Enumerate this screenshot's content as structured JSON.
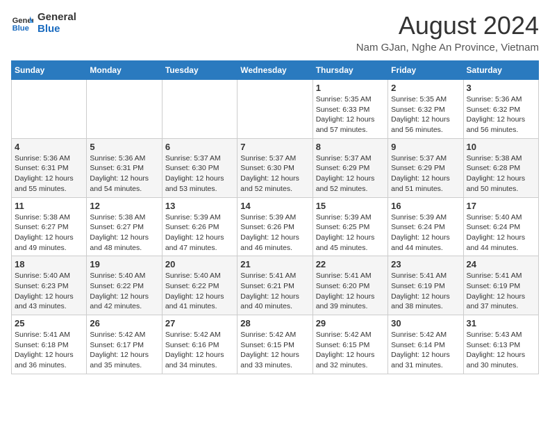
{
  "header": {
    "logo_line1": "General",
    "logo_line2": "Blue",
    "title": "August 2024",
    "subtitle": "Nam GJan, Nghe An Province, Vietnam"
  },
  "days_of_week": [
    "Sunday",
    "Monday",
    "Tuesday",
    "Wednesday",
    "Thursday",
    "Friday",
    "Saturday"
  ],
  "weeks": [
    [
      {
        "day": "",
        "detail": ""
      },
      {
        "day": "",
        "detail": ""
      },
      {
        "day": "",
        "detail": ""
      },
      {
        "day": "",
        "detail": ""
      },
      {
        "day": "1",
        "detail": "Sunrise: 5:35 AM\nSunset: 6:33 PM\nDaylight: 12 hours\nand 57 minutes."
      },
      {
        "day": "2",
        "detail": "Sunrise: 5:35 AM\nSunset: 6:32 PM\nDaylight: 12 hours\nand 56 minutes."
      },
      {
        "day": "3",
        "detail": "Sunrise: 5:36 AM\nSunset: 6:32 PM\nDaylight: 12 hours\nand 56 minutes."
      }
    ],
    [
      {
        "day": "4",
        "detail": "Sunrise: 5:36 AM\nSunset: 6:31 PM\nDaylight: 12 hours\nand 55 minutes."
      },
      {
        "day": "5",
        "detail": "Sunrise: 5:36 AM\nSunset: 6:31 PM\nDaylight: 12 hours\nand 54 minutes."
      },
      {
        "day": "6",
        "detail": "Sunrise: 5:37 AM\nSunset: 6:30 PM\nDaylight: 12 hours\nand 53 minutes."
      },
      {
        "day": "7",
        "detail": "Sunrise: 5:37 AM\nSunset: 6:30 PM\nDaylight: 12 hours\nand 52 minutes."
      },
      {
        "day": "8",
        "detail": "Sunrise: 5:37 AM\nSunset: 6:29 PM\nDaylight: 12 hours\nand 52 minutes."
      },
      {
        "day": "9",
        "detail": "Sunrise: 5:37 AM\nSunset: 6:29 PM\nDaylight: 12 hours\nand 51 minutes."
      },
      {
        "day": "10",
        "detail": "Sunrise: 5:38 AM\nSunset: 6:28 PM\nDaylight: 12 hours\nand 50 minutes."
      }
    ],
    [
      {
        "day": "11",
        "detail": "Sunrise: 5:38 AM\nSunset: 6:27 PM\nDaylight: 12 hours\nand 49 minutes."
      },
      {
        "day": "12",
        "detail": "Sunrise: 5:38 AM\nSunset: 6:27 PM\nDaylight: 12 hours\nand 48 minutes."
      },
      {
        "day": "13",
        "detail": "Sunrise: 5:39 AM\nSunset: 6:26 PM\nDaylight: 12 hours\nand 47 minutes."
      },
      {
        "day": "14",
        "detail": "Sunrise: 5:39 AM\nSunset: 6:26 PM\nDaylight: 12 hours\nand 46 minutes."
      },
      {
        "day": "15",
        "detail": "Sunrise: 5:39 AM\nSunset: 6:25 PM\nDaylight: 12 hours\nand 45 minutes."
      },
      {
        "day": "16",
        "detail": "Sunrise: 5:39 AM\nSunset: 6:24 PM\nDaylight: 12 hours\nand 44 minutes."
      },
      {
        "day": "17",
        "detail": "Sunrise: 5:40 AM\nSunset: 6:24 PM\nDaylight: 12 hours\nand 44 minutes."
      }
    ],
    [
      {
        "day": "18",
        "detail": "Sunrise: 5:40 AM\nSunset: 6:23 PM\nDaylight: 12 hours\nand 43 minutes."
      },
      {
        "day": "19",
        "detail": "Sunrise: 5:40 AM\nSunset: 6:22 PM\nDaylight: 12 hours\nand 42 minutes."
      },
      {
        "day": "20",
        "detail": "Sunrise: 5:40 AM\nSunset: 6:22 PM\nDaylight: 12 hours\nand 41 minutes."
      },
      {
        "day": "21",
        "detail": "Sunrise: 5:41 AM\nSunset: 6:21 PM\nDaylight: 12 hours\nand 40 minutes."
      },
      {
        "day": "22",
        "detail": "Sunrise: 5:41 AM\nSunset: 6:20 PM\nDaylight: 12 hours\nand 39 minutes."
      },
      {
        "day": "23",
        "detail": "Sunrise: 5:41 AM\nSunset: 6:19 PM\nDaylight: 12 hours\nand 38 minutes."
      },
      {
        "day": "24",
        "detail": "Sunrise: 5:41 AM\nSunset: 6:19 PM\nDaylight: 12 hours\nand 37 minutes."
      }
    ],
    [
      {
        "day": "25",
        "detail": "Sunrise: 5:41 AM\nSunset: 6:18 PM\nDaylight: 12 hours\nand 36 minutes."
      },
      {
        "day": "26",
        "detail": "Sunrise: 5:42 AM\nSunset: 6:17 PM\nDaylight: 12 hours\nand 35 minutes."
      },
      {
        "day": "27",
        "detail": "Sunrise: 5:42 AM\nSunset: 6:16 PM\nDaylight: 12 hours\nand 34 minutes."
      },
      {
        "day": "28",
        "detail": "Sunrise: 5:42 AM\nSunset: 6:15 PM\nDaylight: 12 hours\nand 33 minutes."
      },
      {
        "day": "29",
        "detail": "Sunrise: 5:42 AM\nSunset: 6:15 PM\nDaylight: 12 hours\nand 32 minutes."
      },
      {
        "day": "30",
        "detail": "Sunrise: 5:42 AM\nSunset: 6:14 PM\nDaylight: 12 hours\nand 31 minutes."
      },
      {
        "day": "31",
        "detail": "Sunrise: 5:43 AM\nSunset: 6:13 PM\nDaylight: 12 hours\nand 30 minutes."
      }
    ]
  ]
}
